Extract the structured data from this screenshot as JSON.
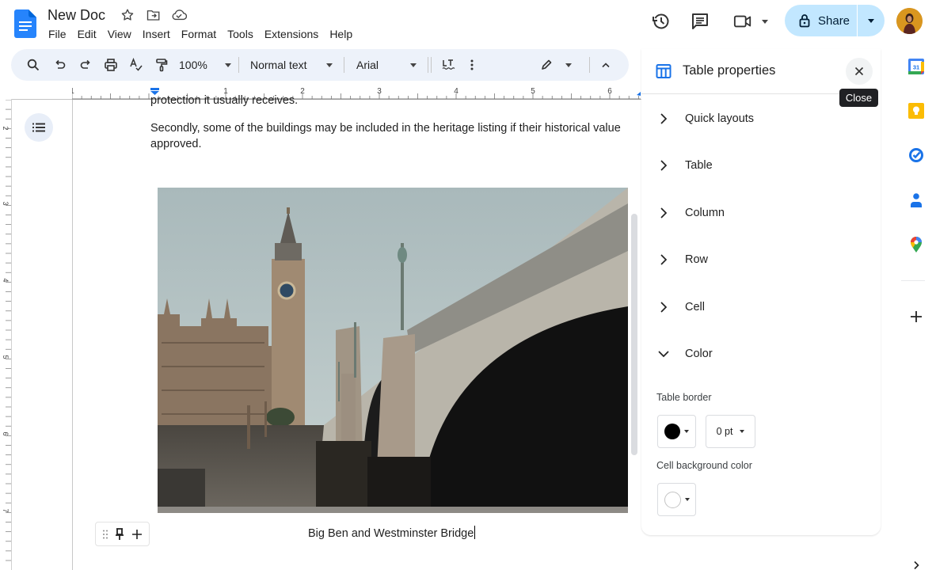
{
  "app": {
    "doc_title": "New Doc",
    "title_icons": [
      "star-icon",
      "move-to-folder-icon",
      "cloud-saved-icon"
    ]
  },
  "menu": {
    "items": [
      "File",
      "Edit",
      "View",
      "Insert",
      "Format",
      "Tools",
      "Extensions",
      "Help"
    ]
  },
  "header": {
    "share_label": "Share",
    "icons": [
      "version-history-icon",
      "comments-icon",
      "meet-icon",
      "lock-icon",
      "avatar"
    ]
  },
  "toolbar": {
    "zoom": "100%",
    "style": "Normal text",
    "font": "Arial",
    "icons": [
      "search-icon",
      "undo-icon",
      "redo-icon",
      "print-icon",
      "spellcheck-icon",
      "paint-format-icon",
      "text-formatting-icon",
      "more-icon",
      "editing-mode-icon",
      "collapse-icon"
    ]
  },
  "ruler": {
    "h_labels": [
      "1",
      "1",
      "2",
      "3",
      "4",
      "5",
      "6"
    ],
    "v_labels": [
      "2",
      "3",
      "4",
      "5",
      "6",
      "7"
    ]
  },
  "document": {
    "clipped_line": "protection it usually receives.",
    "paragraph_line1": "Secondly, some of the buildings may be included in the heritage listing if their historical value",
    "paragraph_line2": "approved.",
    "image_alt": "Big Ben and Westminster Bridge photo",
    "caption": "Big Ben and Westminster Bridge"
  },
  "panel": {
    "title": "Table properties",
    "close_tooltip": "Close",
    "sections": [
      {
        "label": "Quick layouts",
        "expanded": false
      },
      {
        "label": "Table",
        "expanded": false
      },
      {
        "label": "Column",
        "expanded": false
      },
      {
        "label": "Row",
        "expanded": false
      },
      {
        "label": "Cell",
        "expanded": false
      },
      {
        "label": "Color",
        "expanded": true
      }
    ],
    "color": {
      "table_border_label": "Table border",
      "border_color": "#000000",
      "border_width": "0 pt",
      "cell_bg_label": "Cell background color",
      "cell_bg_color": "#ffffff"
    }
  },
  "rail": {
    "icons": [
      "calendar-icon",
      "keep-icon",
      "tasks-icon",
      "contacts-icon",
      "maps-icon",
      "add-addon-icon",
      "expand-panel-icon"
    ],
    "calendar_day": "31"
  },
  "colors": {
    "accent": "#1a73e8",
    "share_bg": "#c2e7ff",
    "toolbar_bg": "#edf2fa"
  }
}
